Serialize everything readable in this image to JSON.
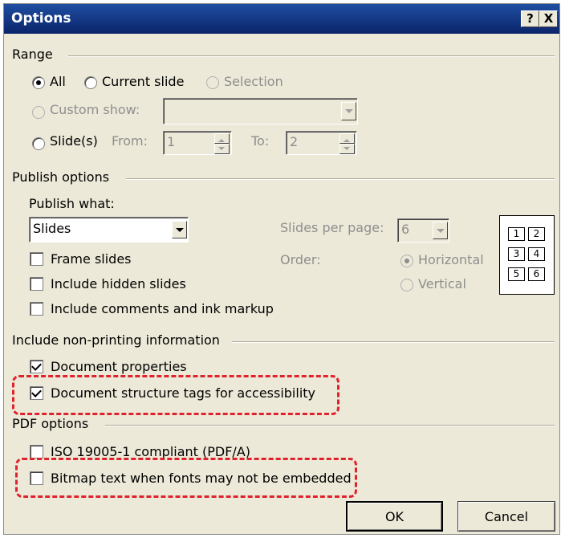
{
  "title": "Options",
  "title_buttons": {
    "help": "?",
    "close": "X"
  },
  "range": {
    "label": "Range",
    "all": "All",
    "current_slide": "Current slide",
    "selection": "Selection",
    "custom_show": "Custom show:",
    "slides": "Slide(s)",
    "from_label": "From:",
    "from_value": "1",
    "to_label": "To:",
    "to_value": "2"
  },
  "publish": {
    "label": "Publish options",
    "publish_what_label": "Publish what:",
    "publish_what_value": "Slides",
    "slides_per_page_label": "Slides per page:",
    "slides_per_page_value": "6",
    "order_label": "Order:",
    "horizontal": "Horizontal",
    "vertical": "Vertical",
    "frame_slides": "Frame slides",
    "include_hidden": "Include hidden slides",
    "include_comments": "Include comments and ink markup",
    "preview_cells": [
      "1",
      "2",
      "3",
      "4",
      "5",
      "6"
    ]
  },
  "nonprinting": {
    "label": "Include non-printing information",
    "doc_properties": "Document properties",
    "doc_structure": "Document structure tags for accessibility"
  },
  "pdf": {
    "label": "PDF options",
    "iso": "ISO 19005-1 compliant (PDF/A)",
    "bitmap": "Bitmap text when fonts may not be embedded"
  },
  "buttons": {
    "ok": "OK",
    "cancel": "Cancel"
  },
  "colors": {
    "highlight": "#e0222c",
    "titlebar": "#0a246a"
  }
}
